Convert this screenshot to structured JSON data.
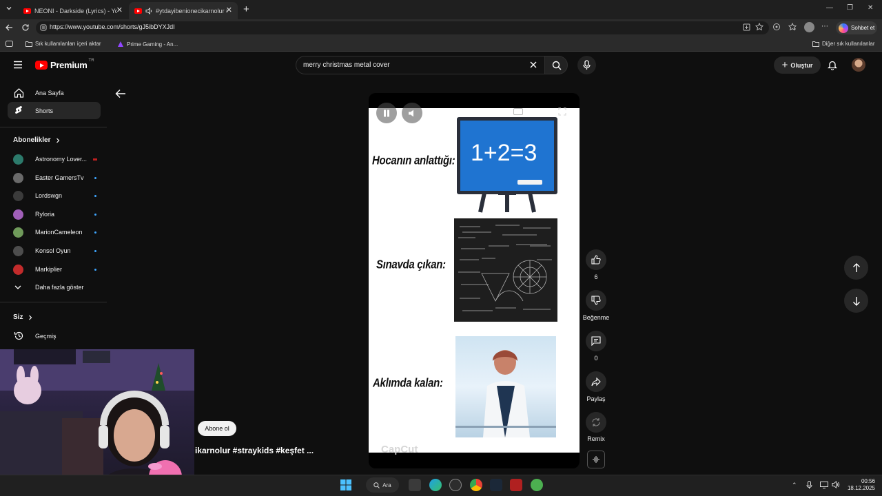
{
  "browser": {
    "tabs": [
      {
        "label": "NEONI - Darkside (Lyrics) - YouTube",
        "active": false
      },
      {
        "label": "#ytdayibenionecikarnolur #straykids",
        "active": true
      }
    ],
    "url": "https://www.youtube.com/shorts/gJ5ibDYXJdI",
    "bookmarks": [
      "Sık kullanılanları içeri aktar",
      "Prime Gaming - An..."
    ],
    "other_bookmarks": "Diğer sık kullanılanlar",
    "copilot_label": "Sohbet et"
  },
  "masthead": {
    "logo_word": "Premium",
    "logo_region": "TR",
    "search_value": "merry christmas metal cover",
    "create_label": "Oluştur"
  },
  "sidebar": {
    "home": "Ana Sayfa",
    "shorts": "Shorts",
    "subscriptions_title": "Abonelikler",
    "subscriptions": [
      {
        "name": "Astronomy Lover...",
        "color": "#2c7a6b"
      },
      {
        "name": "Easter GamersTv",
        "color": "#5b5b5b"
      },
      {
        "name": "Lordswgn",
        "color": "#3b3b3b"
      },
      {
        "name": "Ryloria",
        "color": "#a05fb8"
      },
      {
        "name": "MarionCameleon",
        "color": "#6f9a5a"
      },
      {
        "name": "Konsol Oyun",
        "color": "#4d4d4d"
      },
      {
        "name": "Markiplier",
        "color": "#c22b2b"
      }
    ],
    "show_more": "Daha fazla göster",
    "you_title": "Siz",
    "history": "Geçmiş"
  },
  "video": {
    "label_1": "Hocanın anlattığı:",
    "board_equation": "1+2=3",
    "label_2": "Sınavda çıkan:",
    "label_3": "Aklımda kalan:",
    "watermark": "CapCut",
    "title_partial": "ikarnolur #straykids #keşfet ...",
    "subscribe": "Abone ol"
  },
  "actions": {
    "like_count": "6",
    "dislike_label": "Beğenme",
    "comment_count": "0",
    "share_label": "Paylaş",
    "remix_label": "Remix"
  },
  "taskbar": {
    "search_label": "Ara",
    "time": "00:56",
    "date": "18.12.2025"
  },
  "colors": {
    "yt_red": "#ff0000",
    "background": "#0f0f0f",
    "chalkboard_blue": "#1f74d1"
  }
}
